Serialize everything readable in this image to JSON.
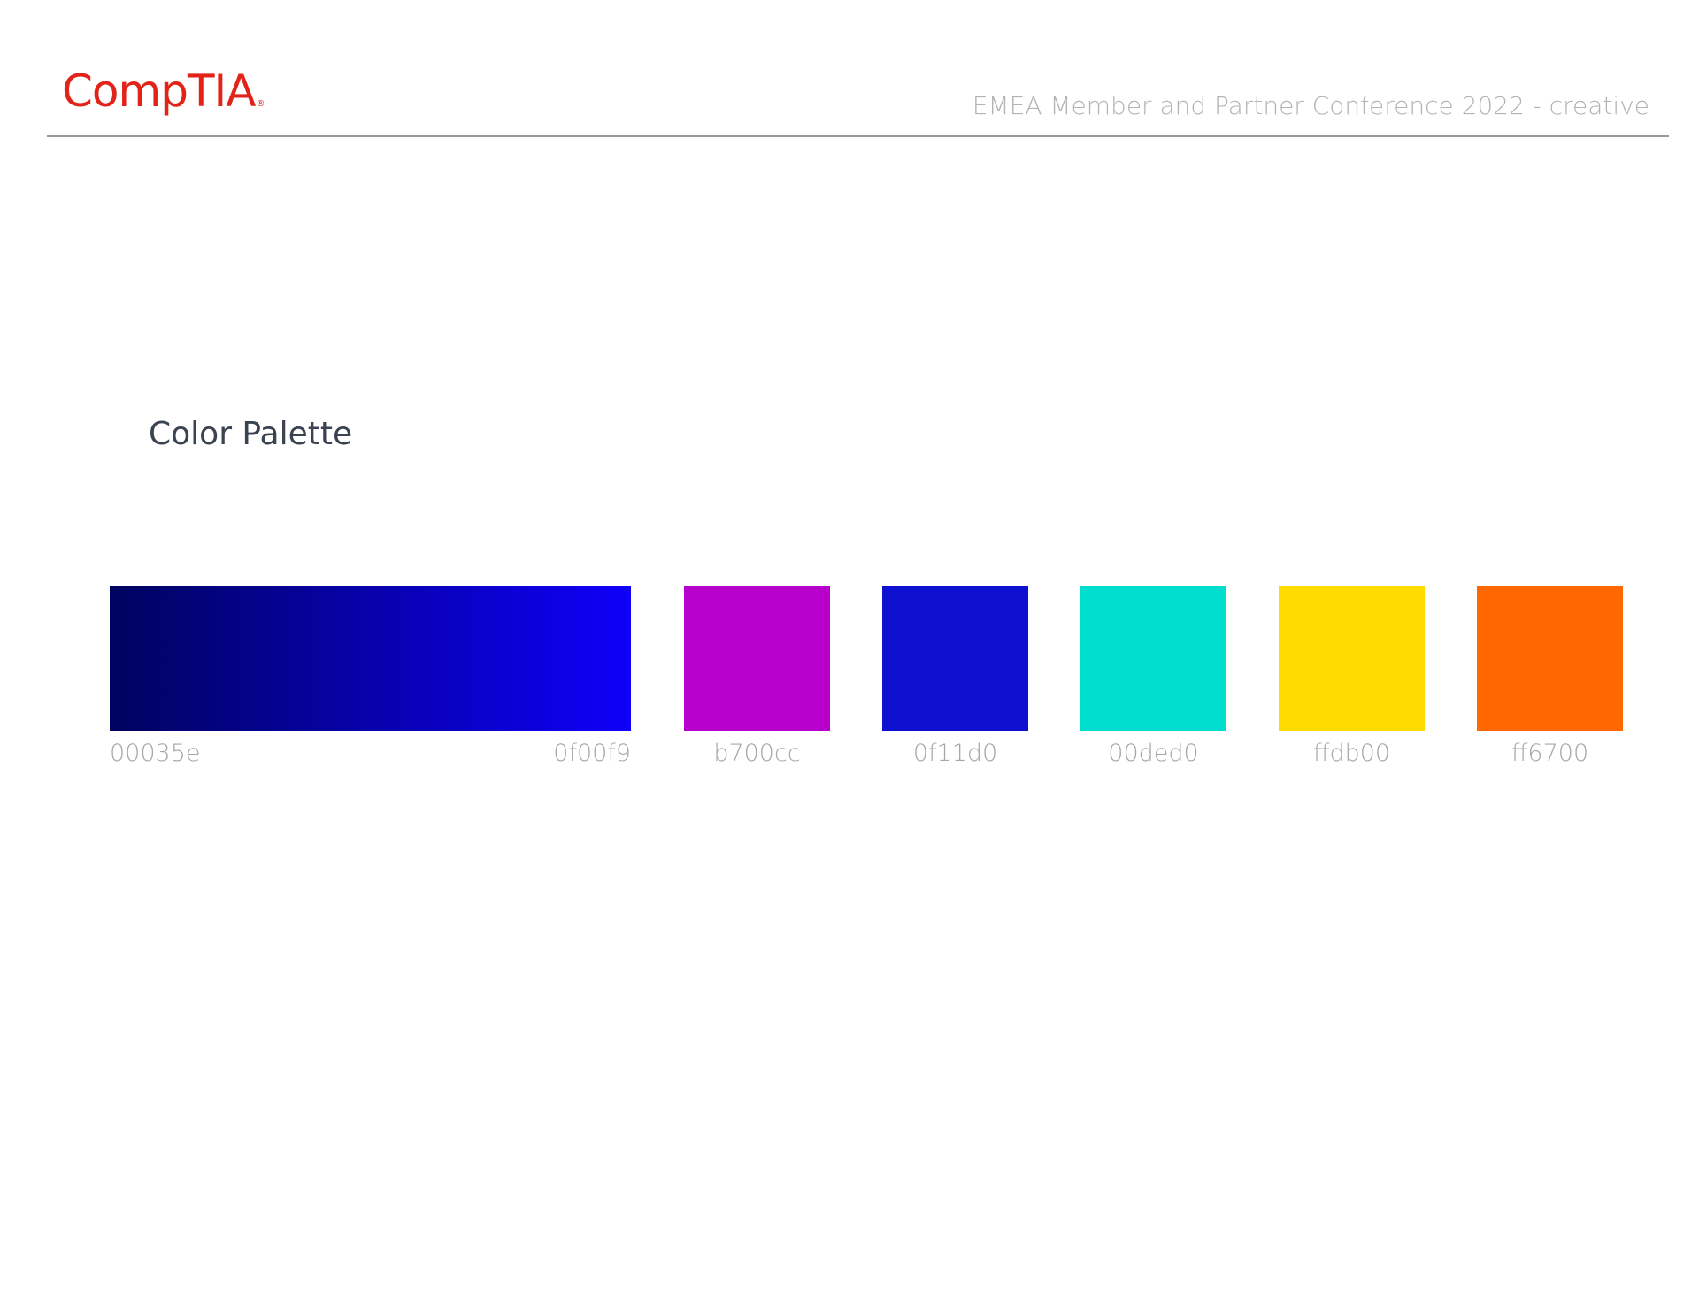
{
  "header": {
    "logo_text": "CompTIA",
    "logo_mark": "®",
    "title": "EMEA Member and Partner Conference 2022 - creative"
  },
  "section": {
    "title": "Color Palette"
  },
  "palette": {
    "gradient": {
      "start_label": "00035e",
      "end_label": "0f00f9",
      "start_color": "#00035e",
      "end_color": "#0f00f9"
    },
    "swatches": [
      {
        "label": "b700cc",
        "color": "#b700cc"
      },
      {
        "label": "0f11d0",
        "color": "#0f11d0"
      },
      {
        "label": "00ded0",
        "color": "#00ded0"
      },
      {
        "label": "ffdb00",
        "color": "#ffdb00"
      },
      {
        "label": "ff6700",
        "color": "#ff6700"
      }
    ]
  },
  "colors": {
    "brand": "#e2231a",
    "rule": "#9a9a9a"
  }
}
